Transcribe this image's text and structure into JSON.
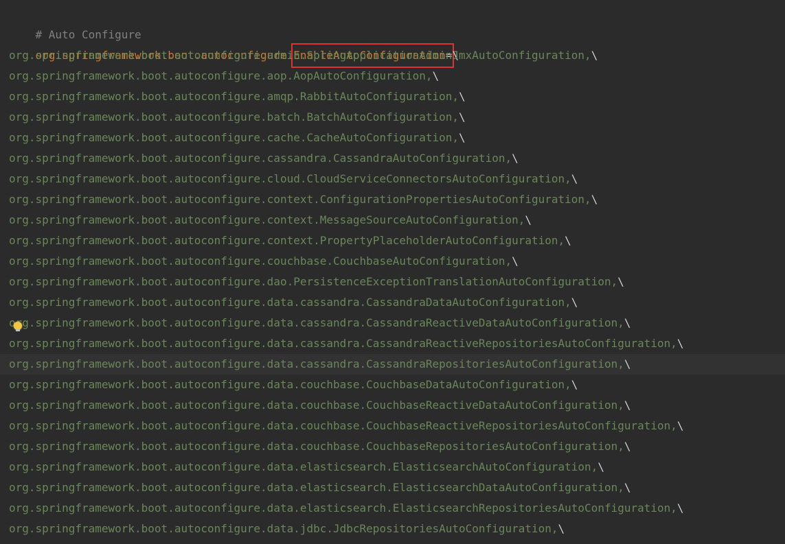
{
  "comment": "# Auto Configure",
  "property_key": "org.springframework.boot.autoconfigure.",
  "highlighted_key": "EnableAutoConfiguration",
  "equals": "=",
  "continuation": "\\",
  "current_line_index": 15,
  "values": [
    "org.springframework.boot.autoconfigure.admin.SpringApplicationAdminJmxAutoConfiguration,",
    "org.springframework.boot.autoconfigure.aop.AopAutoConfiguration,",
    "org.springframework.boot.autoconfigure.amqp.RabbitAutoConfiguration,",
    "org.springframework.boot.autoconfigure.batch.BatchAutoConfiguration,",
    "org.springframework.boot.autoconfigure.cache.CacheAutoConfiguration,",
    "org.springframework.boot.autoconfigure.cassandra.CassandraAutoConfiguration,",
    "org.springframework.boot.autoconfigure.cloud.CloudServiceConnectorsAutoConfiguration,",
    "org.springframework.boot.autoconfigure.context.ConfigurationPropertiesAutoConfiguration,",
    "org.springframework.boot.autoconfigure.context.MessageSourceAutoConfiguration,",
    "org.springframework.boot.autoconfigure.context.PropertyPlaceholderAutoConfiguration,",
    "org.springframework.boot.autoconfigure.couchbase.CouchbaseAutoConfiguration,",
    "org.springframework.boot.autoconfigure.dao.PersistenceExceptionTranslationAutoConfiguration,",
    "org.springframework.boot.autoconfigure.data.cassandra.CassandraDataAutoConfiguration,",
    "org.springframework.boot.autoconfigure.data.cassandra.CassandraReactiveDataAutoConfiguration,",
    "org.springframework.boot.autoconfigure.data.cassandra.CassandraReactiveRepositoriesAutoConfiguration,",
    "org.springframework.boot.autoconfigure.data.cassandra.CassandraRepositoriesAutoConfiguration,",
    "org.springframework.boot.autoconfigure.data.couchbase.CouchbaseDataAutoConfiguration,",
    "org.springframework.boot.autoconfigure.data.couchbase.CouchbaseReactiveDataAutoConfiguration,",
    "org.springframework.boot.autoconfigure.data.couchbase.CouchbaseReactiveRepositoriesAutoConfiguration,",
    "org.springframework.boot.autoconfigure.data.couchbase.CouchbaseRepositoriesAutoConfiguration,",
    "org.springframework.boot.autoconfigure.data.elasticsearch.ElasticsearchAutoConfiguration,",
    "org.springframework.boot.autoconfigure.data.elasticsearch.ElasticsearchDataAutoConfiguration,",
    "org.springframework.boot.autoconfigure.data.elasticsearch.ElasticsearchRepositoriesAutoConfiguration,",
    "org.springframework.boot.autoconfigure.data.jdbc.JdbcRepositoriesAutoConfiguration,"
  ],
  "colors": {
    "background": "#2b2b2b",
    "current_line": "#323232",
    "comment": "#808080",
    "key": "#cc7832",
    "value": "#6a8759",
    "highlight_box": "#e0322f"
  },
  "icons": {
    "intention": "lightbulb-icon"
  }
}
